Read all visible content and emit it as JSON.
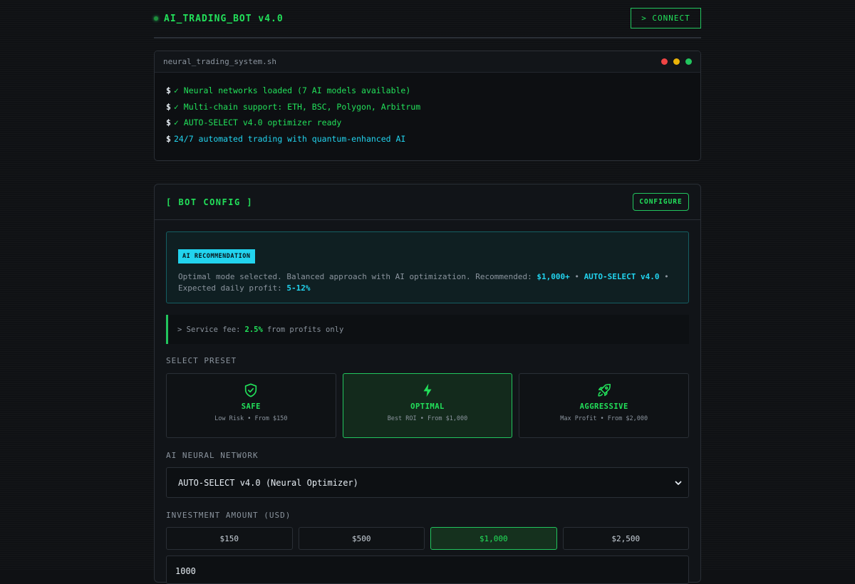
{
  "header": {
    "title": "AI_TRADING_BOT v4.0",
    "connect_label": "> CONNECT"
  },
  "terminal": {
    "filename": "neural_trading_system.sh",
    "lines": [
      {
        "prompt": "$",
        "text": "✓ Neural networks loaded (7 AI models available)"
      },
      {
        "prompt": "$",
        "text": "✓ Multi-chain support: ETH, BSC, Polygon, Arbitrum"
      },
      {
        "prompt": "$",
        "text": "✓ AUTO-SELECT v4.0 optimizer ready"
      },
      {
        "prompt": "$",
        "text": "24/7 automated trading with quantum-enhanced AI"
      }
    ]
  },
  "config": {
    "title": "[ BOT CONFIG ]",
    "configure_label": "CONFIGURE",
    "recommendation": {
      "badge": "AI RECOMMENDATION",
      "text_prefix": "Optimal mode selected. Balanced approach with AI optimization. Recommended:",
      "amount": "$1,000+",
      "sep1": "•",
      "network": "AUTO-SELECT v4.0",
      "sep2": "•",
      "profit_label": "Expected daily profit:",
      "profit": "5-12%"
    },
    "fee": {
      "prefix": "> Service fee:",
      "value": "2.5%",
      "suffix": "from profits only"
    },
    "preset_label": "SELECT PRESET",
    "presets": [
      {
        "name": "SAFE",
        "desc": "Low Risk • From $150",
        "icon": "shield-check-icon"
      },
      {
        "name": "OPTIMAL",
        "desc": "Best ROI • From $1,000",
        "icon": "lightning-icon"
      },
      {
        "name": "AGGRESSIVE",
        "desc": "Max Profit • From $2,000",
        "icon": "rocket-icon"
      }
    ],
    "selected_preset": "OPTIMAL",
    "network_label": "AI NEURAL NETWORK",
    "network_value": "AUTO-SELECT v4.0 (Neural Optimizer)",
    "amount_label": "INVESTMENT AMOUNT (USD)",
    "amounts": [
      "$150",
      "$500",
      "$1,000",
      "$2,500"
    ],
    "selected_amount": "$1,000",
    "amount_value": "1000"
  },
  "colors": {
    "accent_green": "#22e05a",
    "accent_cyan": "#22d3ee",
    "dot_red": "#ef4444",
    "dot_yellow": "#eab308",
    "dot_green": "#22c55e"
  }
}
